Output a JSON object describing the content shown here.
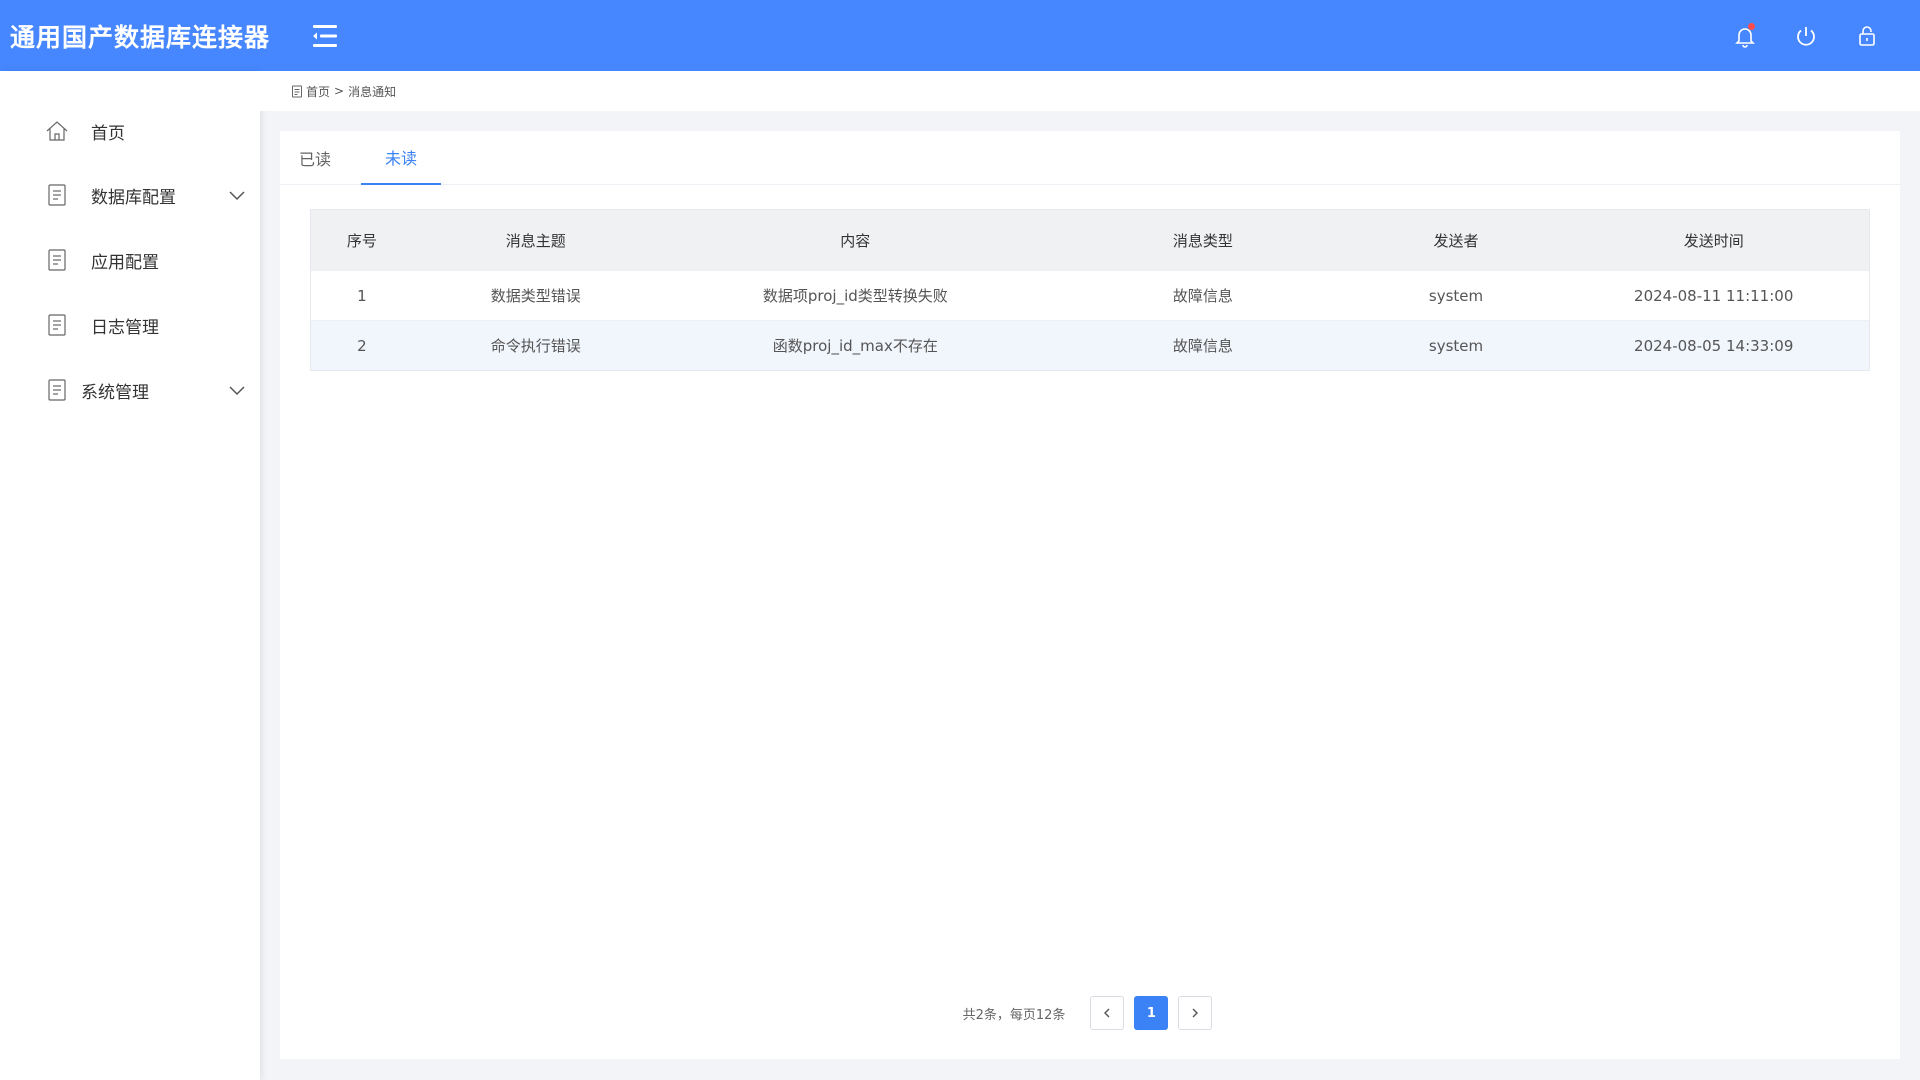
{
  "header": {
    "title": "通用国产数据库连接器",
    "accent_color": "#4687ff",
    "icons": [
      "menu-collapse-icon",
      "bell-icon",
      "power-icon",
      "lock-icon"
    ],
    "has_unread_notification": true
  },
  "sidebar": {
    "items": [
      {
        "label": "首页",
        "icon": "home-icon",
        "expandable": false
      },
      {
        "label": "数据库配置",
        "icon": "document-icon",
        "expandable": true
      },
      {
        "label": "应用配置",
        "icon": "document-icon",
        "expandable": false
      },
      {
        "label": "日志管理",
        "icon": "document-icon",
        "expandable": false
      },
      {
        "label": "系统管理",
        "icon": "document-icon",
        "expandable": true
      }
    ]
  },
  "breadcrumb": {
    "icon": "document-icon",
    "home": "首页",
    "separator": ">",
    "current": "消息通知"
  },
  "tabs": [
    {
      "label": "已读",
      "active": false
    },
    {
      "label": "未读",
      "active": true
    }
  ],
  "table": {
    "columns": [
      "序号",
      "消息主题",
      "内容",
      "消息类型",
      "发送者",
      "发送时间"
    ],
    "rows": [
      [
        "1",
        "数据类型错误",
        "数据项proj_id类型转换失败",
        "故障信息",
        "system",
        "2024-08-11 11:11:00"
      ],
      [
        "2",
        "命令执行错误",
        "函数proj_id_max不存在",
        "故障信息",
        "system",
        "2024-08-05 14:33:09"
      ]
    ]
  },
  "pagination": {
    "summary": "共2条，每页12条",
    "current_page": "1"
  }
}
